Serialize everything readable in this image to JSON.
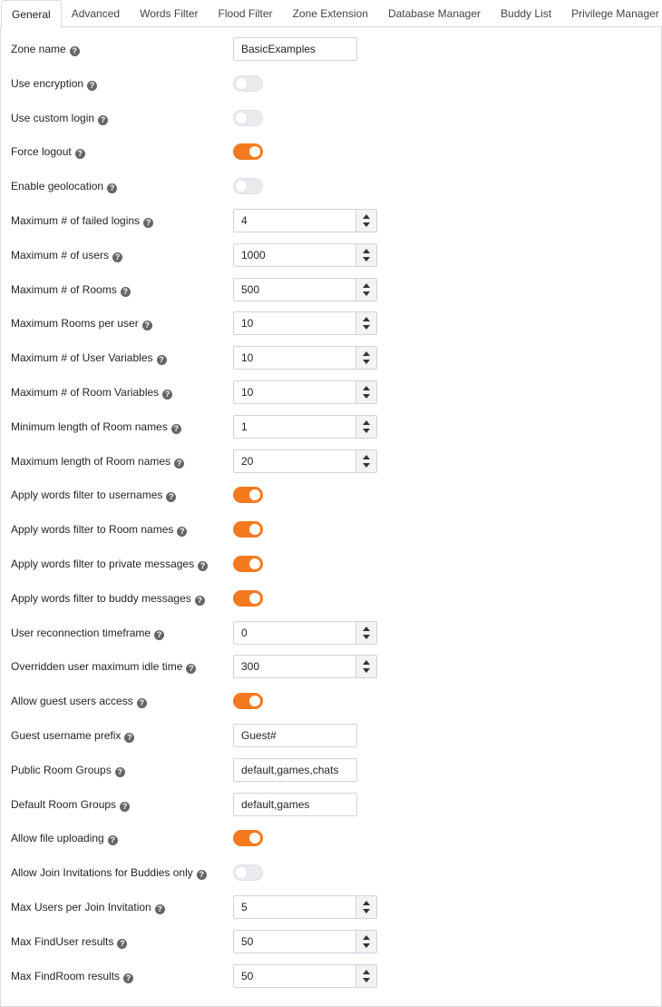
{
  "tabs": [
    "General",
    "Advanced",
    "Words Filter",
    "Flood Filter",
    "Zone Extension",
    "Database Manager",
    "Buddy List",
    "Privilege Manager"
  ],
  "help_glyph": "?",
  "colors": {
    "toggle_on": "#f47a20",
    "toggle_off": "#e8eaed"
  },
  "fields": [
    {
      "label": "Zone name",
      "type": "text",
      "value": "BasicExamples"
    },
    {
      "label": "Use encryption",
      "type": "toggle",
      "checked": false
    },
    {
      "label": "Use custom login",
      "type": "toggle",
      "checked": false
    },
    {
      "label": "Force logout",
      "type": "toggle",
      "checked": true
    },
    {
      "label": "Enable geolocation",
      "type": "toggle",
      "checked": false
    },
    {
      "label": "Maximum # of failed logins",
      "type": "number",
      "value": "4"
    },
    {
      "label": "Maximum # of users",
      "type": "number",
      "value": "1000"
    },
    {
      "label": "Maximum # of Rooms",
      "type": "number",
      "value": "500"
    },
    {
      "label": "Maximum Rooms per user",
      "type": "number",
      "value": "10"
    },
    {
      "label": "Maximum # of User Variables",
      "type": "number",
      "value": "10"
    },
    {
      "label": "Maximum # of Room Variables",
      "type": "number",
      "value": "10"
    },
    {
      "label": "Minimum length of Room names",
      "type": "number",
      "value": "1"
    },
    {
      "label": "Maximum length of Room names",
      "type": "number",
      "value": "20"
    },
    {
      "label": "Apply words filter to usernames",
      "type": "toggle",
      "checked": true
    },
    {
      "label": "Apply words filter to Room names",
      "type": "toggle",
      "checked": true
    },
    {
      "label": "Apply words filter to private messages",
      "type": "toggle",
      "checked": true
    },
    {
      "label": "Apply words filter to buddy messages",
      "type": "toggle",
      "checked": true
    },
    {
      "label": "User reconnection timeframe",
      "type": "number",
      "value": "0"
    },
    {
      "label": "Overridden user maximum idle time",
      "type": "number",
      "value": "300"
    },
    {
      "label": "Allow guest users access",
      "type": "toggle",
      "checked": true
    },
    {
      "label": "Guest username prefix",
      "type": "text",
      "value": "Guest#"
    },
    {
      "label": "Public Room Groups",
      "type": "text",
      "value": "default,games,chats"
    },
    {
      "label": "Default Room Groups",
      "type": "text",
      "value": "default,games"
    },
    {
      "label": "Allow file uploading",
      "type": "toggle",
      "checked": true
    },
    {
      "label": "Allow Join Invitations for Buddies only",
      "type": "toggle",
      "checked": false
    },
    {
      "label": "Max Users per Join Invitation",
      "type": "number",
      "value": "5"
    },
    {
      "label": "Max FindUser results",
      "type": "number",
      "value": "50"
    },
    {
      "label": "Max FindRoom results",
      "type": "number",
      "value": "50"
    }
  ]
}
